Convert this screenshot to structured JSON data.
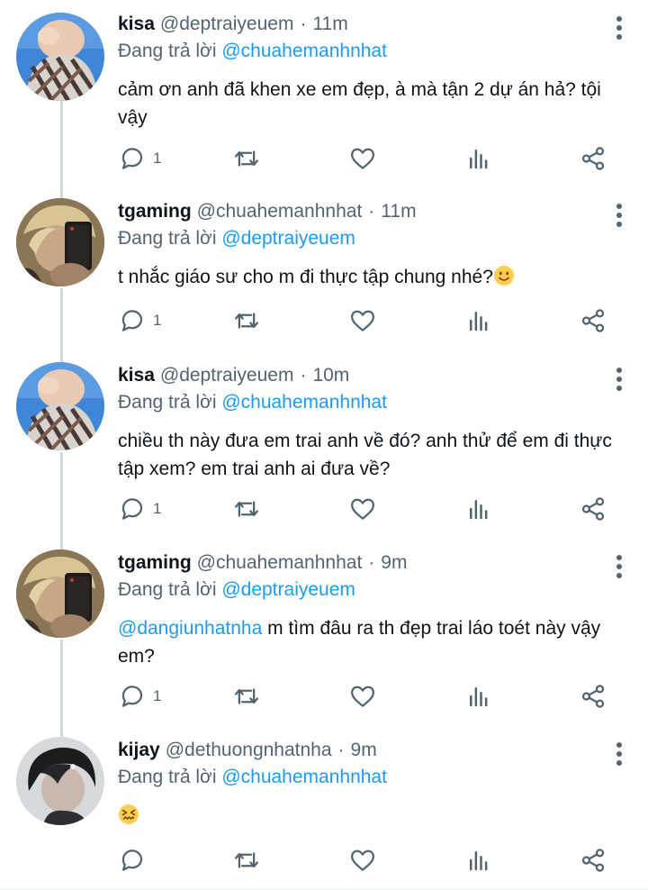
{
  "reply_prefix": "Đang trả lời",
  "colors": {
    "link": "#1d9bf0",
    "secondary_text": "#536471",
    "thread_line": "#cfd9de"
  },
  "tweets": [
    {
      "name": "kisa",
      "handle": "@deptraiyeuem",
      "time": "11m",
      "reply_to": "@chuahemanhnhat",
      "text": "cảm ơn anh đã khen xe em đẹp, à mà tận 2 dự án hả? tội vậy",
      "reply_count": "1",
      "avatar": "kisa-avatar"
    },
    {
      "name": "tgaming",
      "handle": "@chuahemanhnhat",
      "time": "11m",
      "reply_to": "@deptraiyeuem",
      "text": "t nhắc giáo sư cho m đi thực tập chung nhé?",
      "emoji": "slightly-smiling-face",
      "reply_count": "1",
      "avatar": "tgaming-avatar"
    },
    {
      "name": "kisa",
      "handle": "@deptraiyeuem",
      "time": "10m",
      "reply_to": "@chuahemanhnhat",
      "text": "chiều th này đưa em trai anh về đó? anh thử để em đi thực tập xem? em trai anh ai đưa về?",
      "reply_count": "1",
      "avatar": "kisa-avatar"
    },
    {
      "name": "tgaming",
      "handle": "@chuahemanhnhat",
      "time": "9m",
      "reply_to": "@deptraiyeuem",
      "mention": "@dangiunhatnha",
      "text": " m tìm đâu ra th đẹp trai láo toét này vậy em?",
      "reply_count": "1",
      "avatar": "tgaming-avatar"
    },
    {
      "name": "kijay",
      "handle": "@dethuongnhatnha",
      "time": "9m",
      "reply_to": "@chuahemanhnhat",
      "emoji": "confounded-face",
      "reply_count": "",
      "avatar": "kijay-avatar"
    }
  ]
}
